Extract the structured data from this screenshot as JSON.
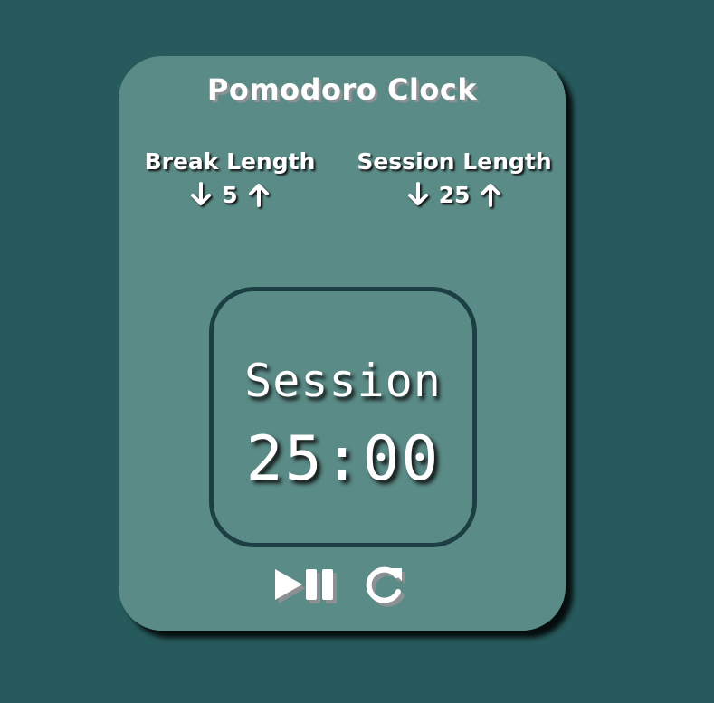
{
  "app": {
    "title": "Pomodoro Clock"
  },
  "break": {
    "label": "Break Length",
    "value": "5",
    "decrement_icon": "arrow-down-icon",
    "increment_icon": "arrow-up-icon"
  },
  "session": {
    "label": "Session Length",
    "value": "25",
    "decrement_icon": "arrow-down-icon",
    "increment_icon": "arrow-up-icon"
  },
  "timer": {
    "label": "Session",
    "time": "25:00"
  },
  "controls": {
    "play_pause_icon": "play-pause-icon",
    "reset_icon": "refresh-icon"
  },
  "colors": {
    "page_background": "#275a5c",
    "card_background": "#5a8b87",
    "timer_border": "#1c3f43",
    "text": "#ffffff"
  }
}
